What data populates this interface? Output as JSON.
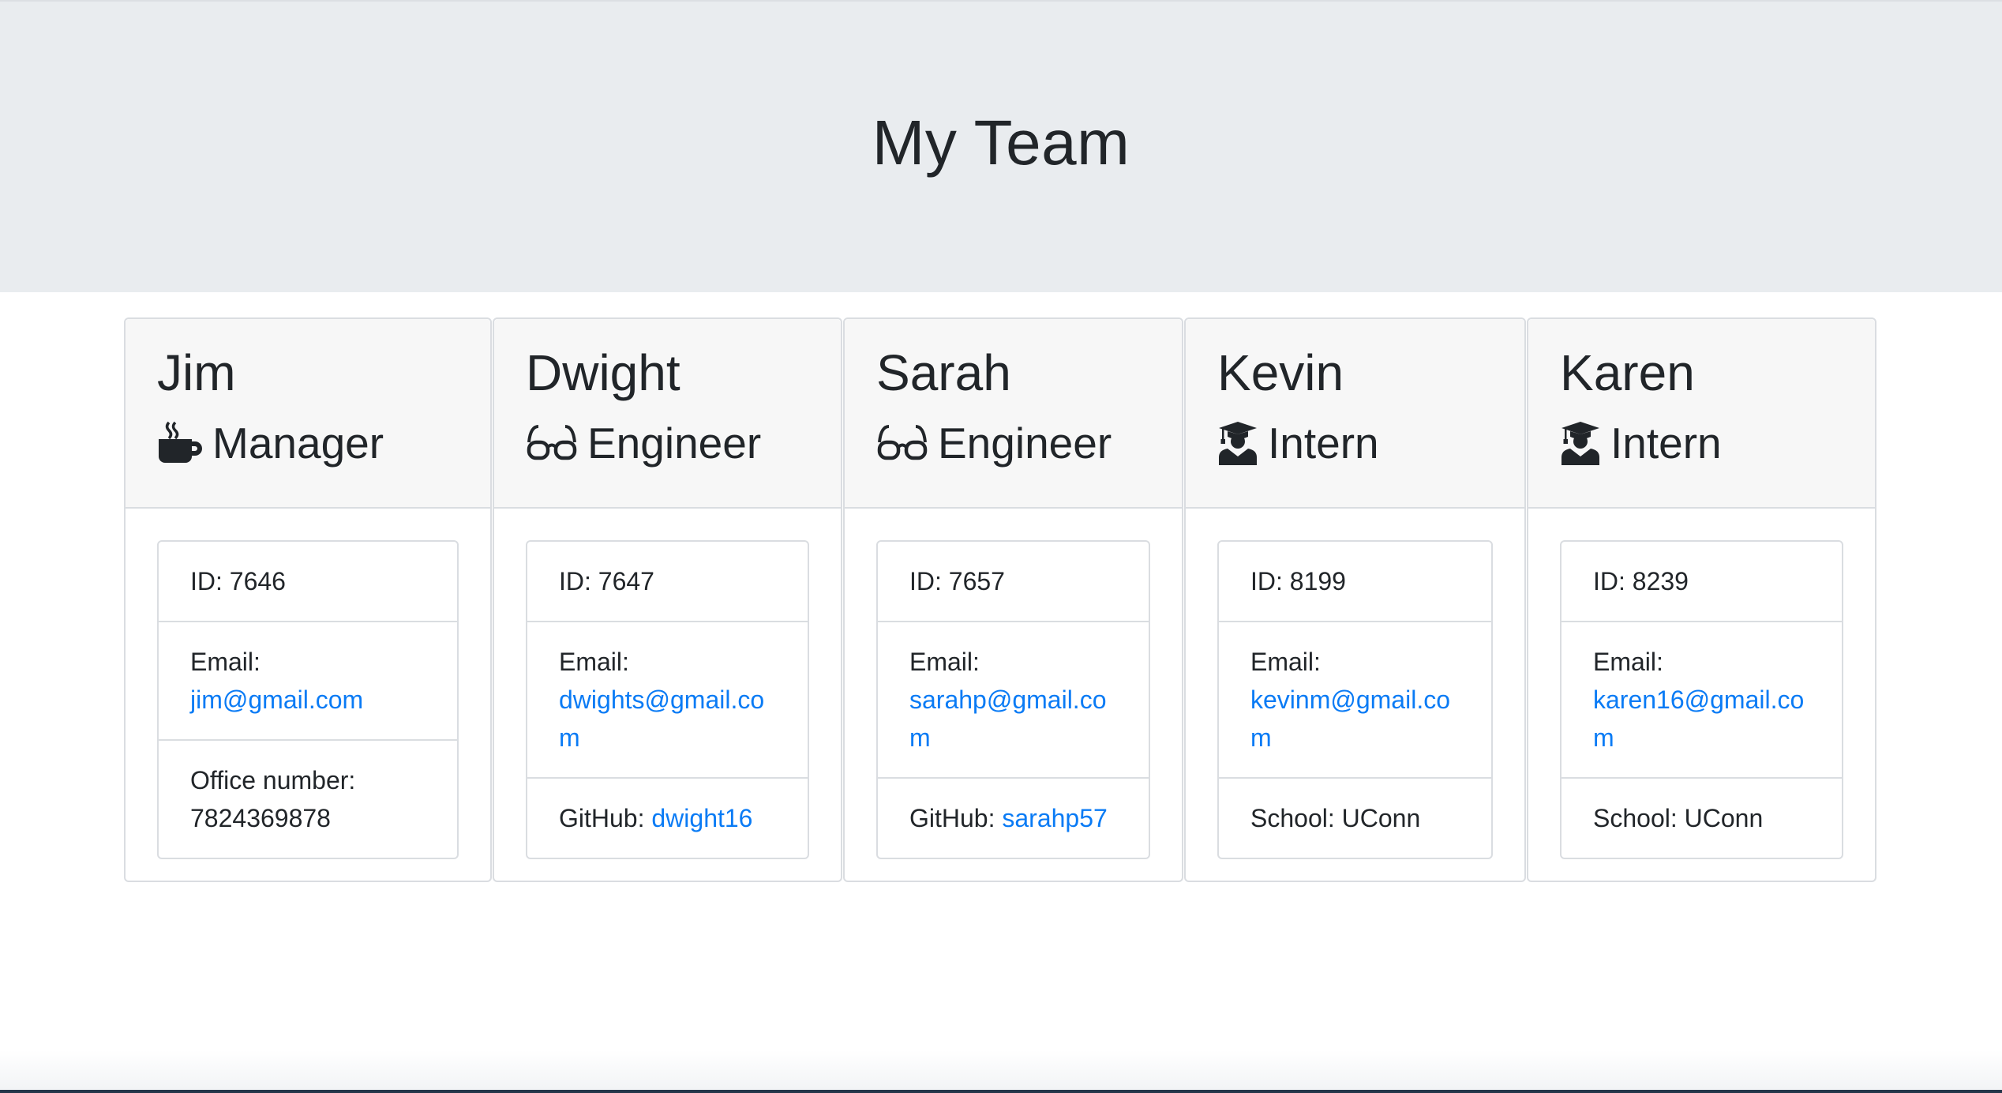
{
  "header": {
    "title": "My Team"
  },
  "employees": [
    {
      "name": "Jim",
      "role": "Manager",
      "role_icon": "mug-hot-icon",
      "id_label": "ID: 7646",
      "email_label": "Email:",
      "email": "jim@gmail.com",
      "extra_label": "Office number:",
      "extra_value": "7824369878"
    },
    {
      "name": "Dwight",
      "role": "Engineer",
      "role_icon": "glasses-icon",
      "id_label": "ID: 7647",
      "email_label": "Email:",
      "email": "dwights@gmail.com",
      "extra_label": "GitHub:",
      "extra_value": "dwight16"
    },
    {
      "name": "Sarah",
      "role": "Engineer",
      "role_icon": "glasses-icon",
      "id_label": "ID: 7657",
      "email_label": "Email:",
      "email": "sarahp@gmail.com",
      "extra_label": "GitHub:",
      "extra_value": "sarahp57"
    },
    {
      "name": "Kevin",
      "role": "Intern",
      "role_icon": "graduate-icon",
      "id_label": "ID: 8199",
      "email_label": "Email:",
      "email": "kevinm@gmail.com",
      "extra_label": "School: UConn",
      "extra_value": ""
    },
    {
      "name": "Karen",
      "role": "Intern",
      "role_icon": "graduate-icon",
      "id_label": "ID: 8239",
      "email_label": "Email:",
      "email": "karen16@gmail.com",
      "extra_label": "School: UConn",
      "extra_value": ""
    }
  ],
  "colors": {
    "header_bg": "#e9ecef",
    "card_header_bg": "#f7f7f7",
    "link": "#0a7bf5",
    "text": "#212529"
  }
}
